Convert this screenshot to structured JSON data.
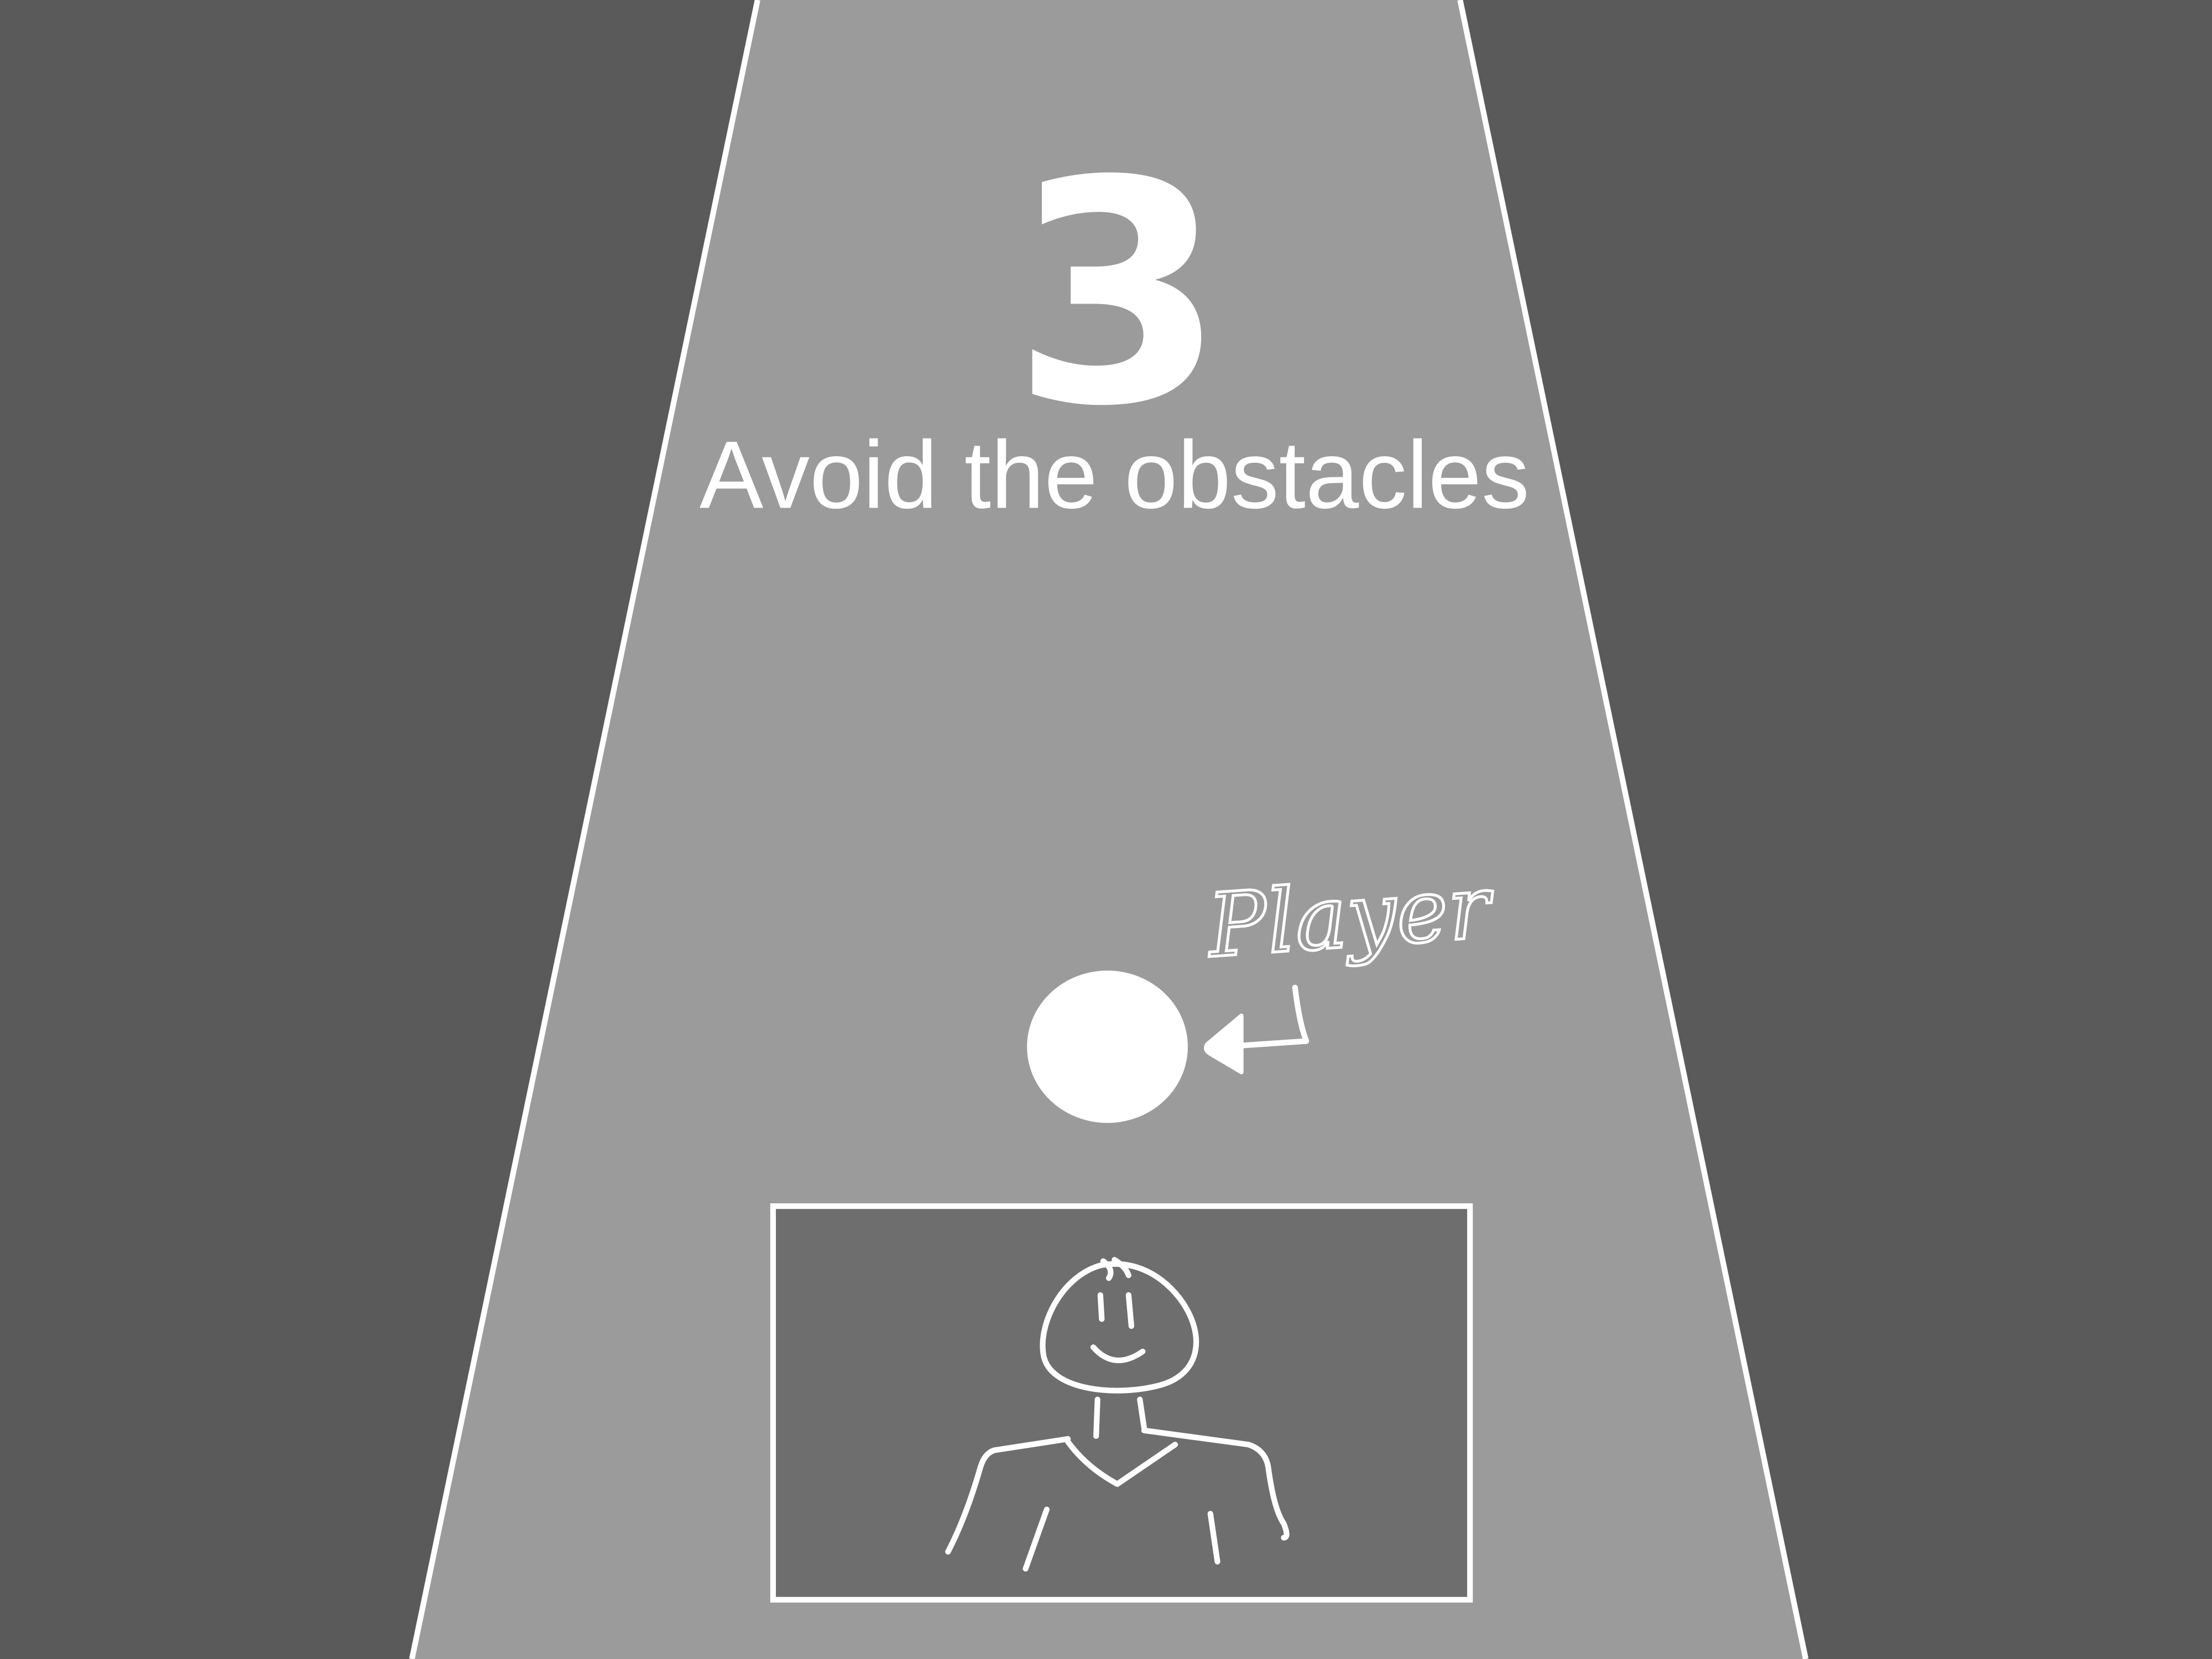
{
  "game": {
    "countdown": "3",
    "instruction": "Avoid the obstacles",
    "player_label": "Player"
  },
  "colors": {
    "background": "#5a5a5a",
    "road": "#9b9b9b",
    "camera_box": "#6e6e6e",
    "lines": "#ffffff"
  },
  "icons": {
    "player": "white-circle",
    "pointer": "hand-drawn-arrow",
    "webcam_person": "stick-figure"
  }
}
